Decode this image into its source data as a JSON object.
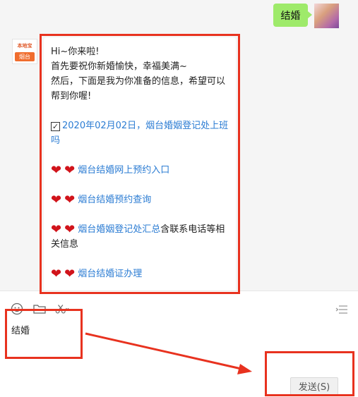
{
  "chat": {
    "sent_message": "结婚",
    "bot_avatar": {
      "logo_top": "本地宝",
      "logo_bottom": "烟台"
    },
    "reply": {
      "greeting": "Hi~你来啦!",
      "line2": "首先要祝你新婚愉快，幸福美满~",
      "line3": "然后，下面是我为你准备的信息，希望可以帮到你喔!",
      "checkbox_link": "2020年02月02日，烟台婚姻登记处上班吗",
      "links": [
        {
          "label": "烟台结婚网上预约入口",
          "suffix": ""
        },
        {
          "label": "烟台结婚预约查询",
          "suffix": ""
        },
        {
          "label": "烟台婚姻登记处汇总",
          "suffix": "含联系电话等相关信息"
        },
        {
          "label": "烟台结婚证办理",
          "suffix": ""
        }
      ]
    }
  },
  "input": {
    "text": "结婚",
    "send_label": "发送(S)"
  },
  "icons": {
    "emoji": "emoji-icon",
    "folder": "folder-icon",
    "scissors": "scissors-icon",
    "history": "history-icon",
    "heart": "heart-icon",
    "checkbox": "checkbox-icon"
  },
  "colors": {
    "my_bubble": "#9eea6a",
    "link": "#2b7cd3",
    "annotation": "#e8321f"
  }
}
